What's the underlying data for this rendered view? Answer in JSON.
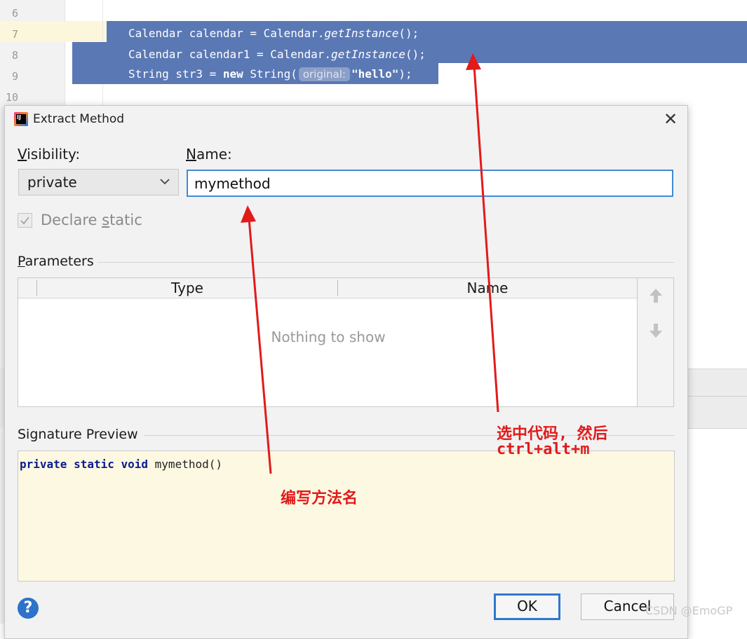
{
  "editor": {
    "line_numbers": [
      "6",
      "7",
      "8",
      "9",
      "10"
    ],
    "lines": [
      {
        "a": "Calendar calendar = Calendar.",
        "method": "getInstance",
        "b": "();"
      },
      {
        "a": "Calendar calendar1 = Calendar.",
        "method": "getInstance",
        "b": "();"
      },
      {
        "a": "String str3 = ",
        "kw": "new",
        "c": " String(",
        "hint": "original:",
        "str": "\"hello\"",
        "d": ");"
      }
    ]
  },
  "dialog": {
    "title": "Extract Method",
    "visibility_label_u": "V",
    "visibility_label_rest": "isibility:",
    "visibility_value": "private",
    "name_label_u": "N",
    "name_label_rest": "ame:",
    "name_value": "mymethod",
    "declare_static_a": "Declare ",
    "declare_static_u": "s",
    "declare_static_b": "tatic",
    "parameters_u": "P",
    "parameters_rest": "arameters",
    "columns": [
      "Type",
      "Name"
    ],
    "empty_text": "Nothing to show",
    "signature_title": "Signature Preview",
    "signature": {
      "kw": "private static void",
      "rest": " mymethod()"
    },
    "ok_label": "OK",
    "cancel_label": "Cancel"
  },
  "annotations": {
    "note_select_line1": "选中代码, 然后",
    "note_select_line2": "ctrl+alt+m",
    "note_name": "编写方法名"
  },
  "watermark": "CSDN @EmoGP",
  "colors": {
    "selection": "#5a78b4",
    "accent": "#3f8bd8",
    "annotation": "#e21a1a"
  }
}
